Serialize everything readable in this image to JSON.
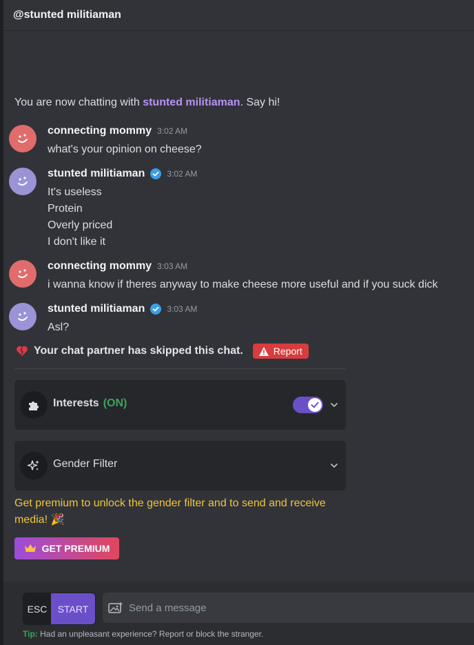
{
  "header": {
    "title": "@stunted militiaman"
  },
  "intro": {
    "prefix": "You are now chatting with ",
    "name": "stunted militiaman",
    "suffix": ". Say hi!"
  },
  "messages": [
    {
      "author": "connecting mommy",
      "time": "3:02 AM",
      "verified": false,
      "avatar_color": "#e06c6c",
      "lines": [
        "what's your opinion on cheese?"
      ]
    },
    {
      "author": "stunted militiaman",
      "time": "3:02 AM",
      "verified": true,
      "avatar_color": "#9a93d6",
      "lines": [
        "It's useless",
        "Protein",
        "Overly priced",
        "I don't like it"
      ]
    },
    {
      "author": "connecting mommy",
      "time": "3:03 AM",
      "verified": false,
      "avatar_color": "#e06c6c",
      "lines": [
        "i wanna know if theres anyway to make cheese more useful and if you suck dick"
      ]
    },
    {
      "author": "stunted militiaman",
      "time": "3:03 AM",
      "verified": true,
      "avatar_color": "#9a93d6",
      "lines": [
        "Asl?"
      ]
    }
  ],
  "skip_notice": {
    "text": "Your chat partner has skipped this chat.",
    "report_label": "Report"
  },
  "interests": {
    "label": "Interests",
    "status": "(ON)",
    "toggle_on": true
  },
  "gender_filter": {
    "label": "Gender Filter"
  },
  "premium": {
    "text": "Get premium to unlock the gender filter and to send and receive media! 🎉",
    "button_label": "GET PREMIUM"
  },
  "composer": {
    "esc_label": "ESC",
    "start_label": "START",
    "placeholder": "Send a message"
  },
  "tip": {
    "label": "Tip:",
    "text": " Had an unpleasant experience? Report or block the stranger."
  },
  "colors": {
    "accent": "#6b4fc9",
    "name_highlight": "#b892f5",
    "premium_text": "#f0c43f",
    "report": "#d83c3e",
    "on_green": "#3ba55c"
  }
}
